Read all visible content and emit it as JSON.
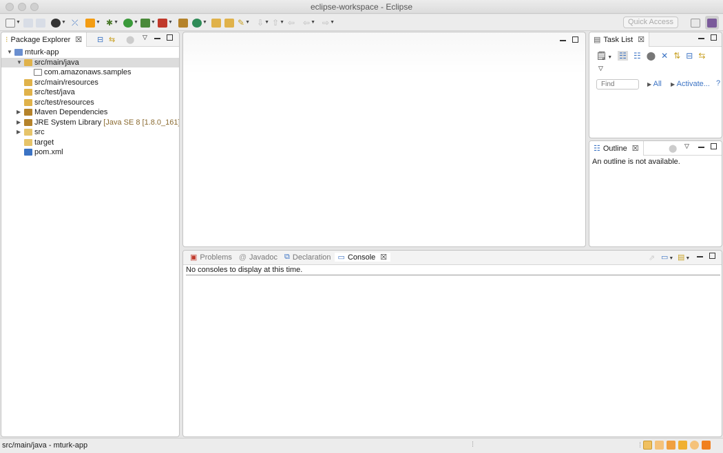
{
  "window": {
    "title": "eclipse-workspace - Eclipse"
  },
  "toolbar": {
    "quick_access": "Quick Access"
  },
  "package_explorer": {
    "tab_label": "Package Explorer",
    "items": [
      {
        "label": "mturk-app",
        "decoration": "",
        "level": 0,
        "expanded": true,
        "icon": "project-icon"
      },
      {
        "label": "src/main/java",
        "decoration": "",
        "level": 1,
        "expanded": true,
        "selected": true,
        "icon": "source-folder-icon"
      },
      {
        "label": "com.amazonaws.samples",
        "decoration": "",
        "level": 2,
        "icon": "package-icon"
      },
      {
        "label": "src/main/resources",
        "decoration": "",
        "level": 1,
        "icon": "source-folder-icon"
      },
      {
        "label": "src/test/java",
        "decoration": "",
        "level": 1,
        "icon": "source-folder-icon"
      },
      {
        "label": "src/test/resources",
        "decoration": "",
        "level": 1,
        "icon": "source-folder-icon"
      },
      {
        "label": "Maven Dependencies",
        "decoration": "",
        "level": 1,
        "collapsed": true,
        "icon": "library-icon"
      },
      {
        "label": "JRE System Library",
        "decoration": "[Java SE 8 [1.8.0_161]]",
        "level": 1,
        "collapsed": true,
        "icon": "library-icon"
      },
      {
        "label": "src",
        "decoration": "",
        "level": 1,
        "collapsed": true,
        "icon": "folder-icon"
      },
      {
        "label": "target",
        "decoration": "",
        "level": 1,
        "icon": "folder-icon"
      },
      {
        "label": "pom.xml",
        "decoration": "",
        "level": 1,
        "icon": "maven-file-icon"
      }
    ]
  },
  "task_list": {
    "tab_label": "Task List",
    "find_placeholder": "Find",
    "all_label": "All",
    "activate_label": "Activate..."
  },
  "outline": {
    "tab_label": "Outline",
    "message": "An outline is not available."
  },
  "bottom_panel": {
    "tabs": [
      {
        "label": "Problems",
        "active": false
      },
      {
        "label": "Javadoc",
        "active": false
      },
      {
        "label": "Declaration",
        "active": false
      },
      {
        "label": "Console",
        "active": true
      }
    ],
    "console_message": "No consoles to display at this time."
  },
  "status_bar": {
    "text": "src/main/java - mturk-app"
  },
  "colors": {
    "accent": "#3b73c4",
    "selection": "#dcdcdc",
    "decoration": "#8a6a30"
  }
}
